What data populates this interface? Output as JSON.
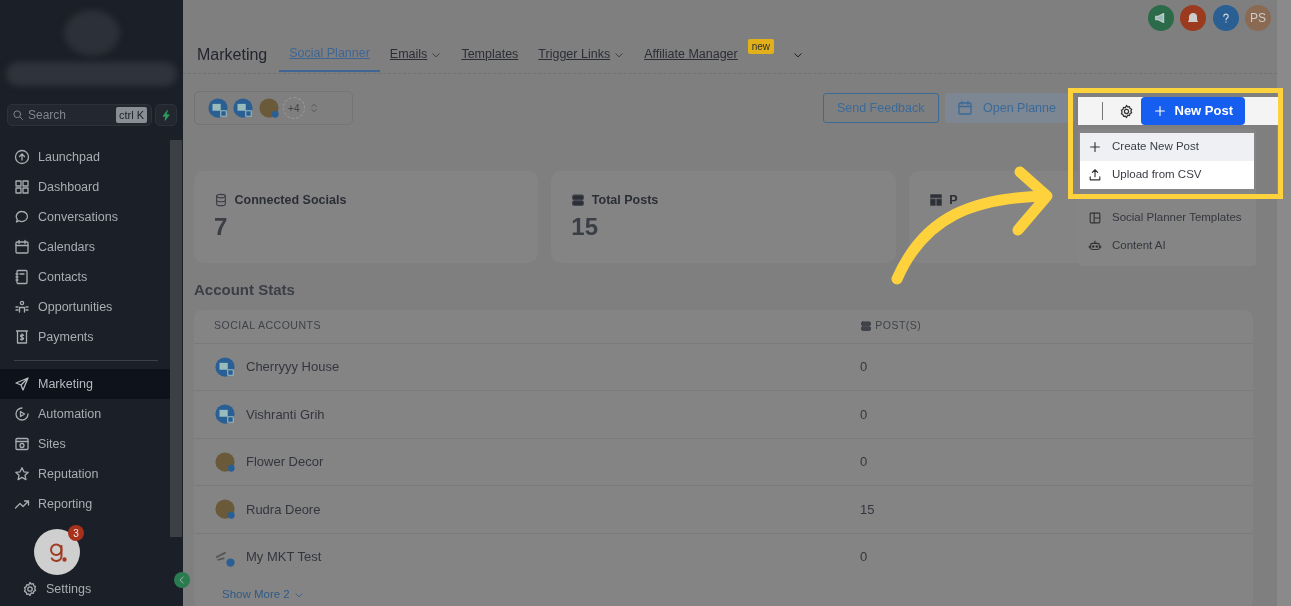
{
  "sidebar": {
    "search": {
      "placeholder": "Search",
      "shortcut": "ctrl K"
    },
    "groups": [
      [
        {
          "label": "Launchpad",
          "selected": false
        },
        {
          "label": "Dashboard",
          "selected": false
        },
        {
          "label": "Conversations",
          "selected": false
        },
        {
          "label": "Calendars",
          "selected": false
        },
        {
          "label": "Contacts",
          "selected": false
        },
        {
          "label": "Opportunities",
          "selected": false
        },
        {
          "label": "Payments",
          "selected": false
        }
      ],
      [
        {
          "label": "Marketing",
          "selected": true
        },
        {
          "label": "Automation",
          "selected": false
        },
        {
          "label": "Sites",
          "selected": false
        },
        {
          "label": "Reputation",
          "selected": false
        },
        {
          "label": "Reporting",
          "selected": false
        }
      ]
    ],
    "helper_badge": "3",
    "settings": "Settings"
  },
  "header": {
    "avatar": "PS"
  },
  "nav": {
    "title": "Marketing",
    "tabs": [
      {
        "label": "Social Planner",
        "selected": true,
        "dropdown": false
      },
      {
        "label": "Emails",
        "selected": false,
        "dropdown": true
      },
      {
        "label": "Templates",
        "selected": false,
        "dropdown": false
      },
      {
        "label": "Trigger Links",
        "selected": false,
        "dropdown": true
      },
      {
        "label": "Affiliate Manager",
        "selected": false,
        "dropdown": false,
        "badge": "new"
      }
    ]
  },
  "toolbar": {
    "more_accounts": "+4",
    "buttons": [
      "Send Feedback",
      "Open Planne"
    ],
    "primary": "New Post"
  },
  "menu": [
    {
      "label": "Create New Post",
      "spotlit": true,
      "hovered": true
    },
    {
      "label": "Upload from CSV",
      "spotlit": true,
      "hovered": false
    },
    {
      "label": "Social Planner Templates",
      "spotlit": false,
      "hovered": false
    },
    {
      "label": "Content AI",
      "spotlit": false,
      "hovered": false
    }
  ],
  "stats": [
    {
      "label": "Connected Socials",
      "value": "7"
    },
    {
      "label": "Total Posts",
      "value": "15"
    },
    {
      "label": "P"
    }
  ],
  "account_stats": {
    "title": "Account Stats",
    "columns": [
      "SOCIAL ACCOUNTS",
      "POST(S)"
    ],
    "rows": [
      {
        "name": "Cherryyy House",
        "posts": "0",
        "kind": "brand"
      },
      {
        "name": "Vishranti Grih",
        "posts": "0",
        "kind": "brand"
      },
      {
        "name": "Flower Decor",
        "posts": "0",
        "kind": "photo"
      },
      {
        "name": "Rudra Deore",
        "posts": "15",
        "kind": "photo"
      },
      {
        "name": "My MKT Test",
        "posts": "0",
        "kind": "linkedin"
      }
    ],
    "show_more": "Show More 2"
  }
}
